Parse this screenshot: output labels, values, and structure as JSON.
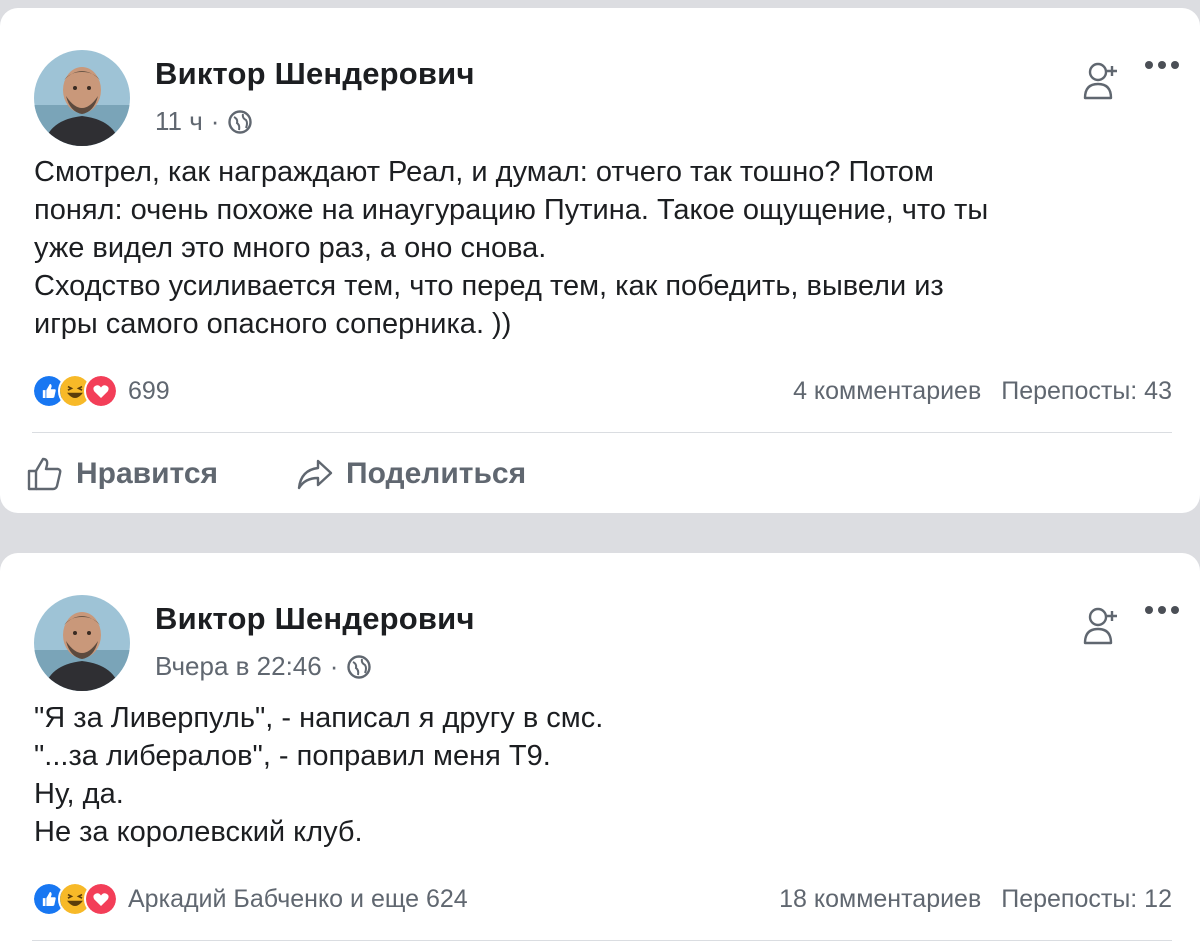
{
  "posts": [
    {
      "author": "Виктор Шендерович",
      "time": "11 ч",
      "separator": "·",
      "text": "Смотрел, как награждают Реал, и думал: отчего так тошно? Потом\nпонял: очень похоже на инаугурацию Путина. Такое ощущение, что ты\nуже видел это много раз, а оно снова.\nСходство усиливается тем, что перед тем, как победить, вывели из\nигры самого опасного соперника. ))",
      "reactions_text": "699",
      "comments": "4 комментариев",
      "shares": "Перепосты: 43",
      "actions": {
        "like": "Нравится",
        "share": "Поделиться"
      }
    },
    {
      "author": "Виктор Шендерович",
      "time": "Вчера в 22:46",
      "separator": "·",
      "text": "\"Я за Ливерпуль\", - написал я другу в смс.\n\"...за либералов\", - поправил меня Т9.\nНу, да.\nНе за королевский клуб.",
      "reactions_text": "Аркадий Бабченко и еще 624",
      "comments": "18 комментариев",
      "shares": "Перепосты: 12"
    }
  ],
  "icons": {
    "privacy": "globe-icon",
    "add_friend": "add-friend-icon",
    "more": "more-icon",
    "like": "like-icon",
    "share": "share-icon",
    "reactions": [
      "like-reaction-icon",
      "haha-reaction-icon",
      "love-reaction-icon"
    ]
  },
  "colors": {
    "like_blue": "#1877f2",
    "haha_yellow": "#f7b928",
    "love_red": "#f33e58",
    "secondary_text": "#606770",
    "background": "#dcdde1"
  }
}
